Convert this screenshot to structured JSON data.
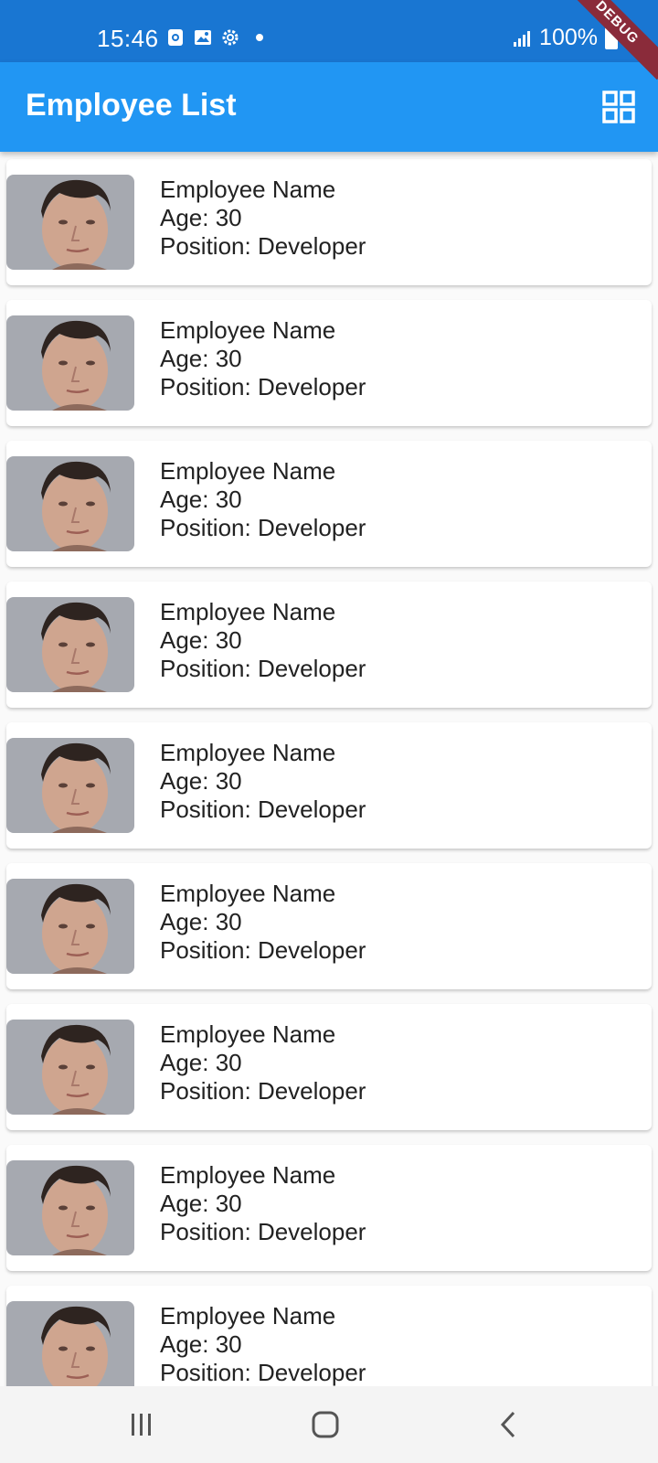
{
  "status_bar": {
    "time": "15:46",
    "battery": "100%",
    "icons": [
      "camera-notification-icon",
      "gallery-icon",
      "settings-icon",
      "dot-icon",
      "signal-icon",
      "battery-icon"
    ]
  },
  "debug_banner": "DEBUG",
  "app_bar": {
    "title": "Employee List",
    "action_icon": "grid-view-icon"
  },
  "employees": [
    {
      "name": "Employee Name",
      "age": "Age: 30",
      "position": "Position: Developer"
    },
    {
      "name": "Employee Name",
      "age": "Age: 30",
      "position": "Position: Developer"
    },
    {
      "name": "Employee Name",
      "age": "Age: 30",
      "position": "Position: Developer"
    },
    {
      "name": "Employee Name",
      "age": "Age: 30",
      "position": "Position: Developer"
    },
    {
      "name": "Employee Name",
      "age": "Age: 30",
      "position": "Position: Developer"
    },
    {
      "name": "Employee Name",
      "age": "Age: 30",
      "position": "Position: Developer"
    },
    {
      "name": "Employee Name",
      "age": "Age: 30",
      "position": "Position: Developer"
    },
    {
      "name": "Employee Name",
      "age": "Age: 30",
      "position": "Position: Developer"
    },
    {
      "name": "Employee Name",
      "age": "Age: 30",
      "position": "Position: Developer"
    }
  ],
  "nav_bar": {
    "icons": [
      "recent-apps-icon",
      "home-icon",
      "back-icon"
    ]
  },
  "colors": {
    "status_bar": "#1976d2",
    "app_bar": "#2196f3",
    "background": "#fafafa"
  }
}
